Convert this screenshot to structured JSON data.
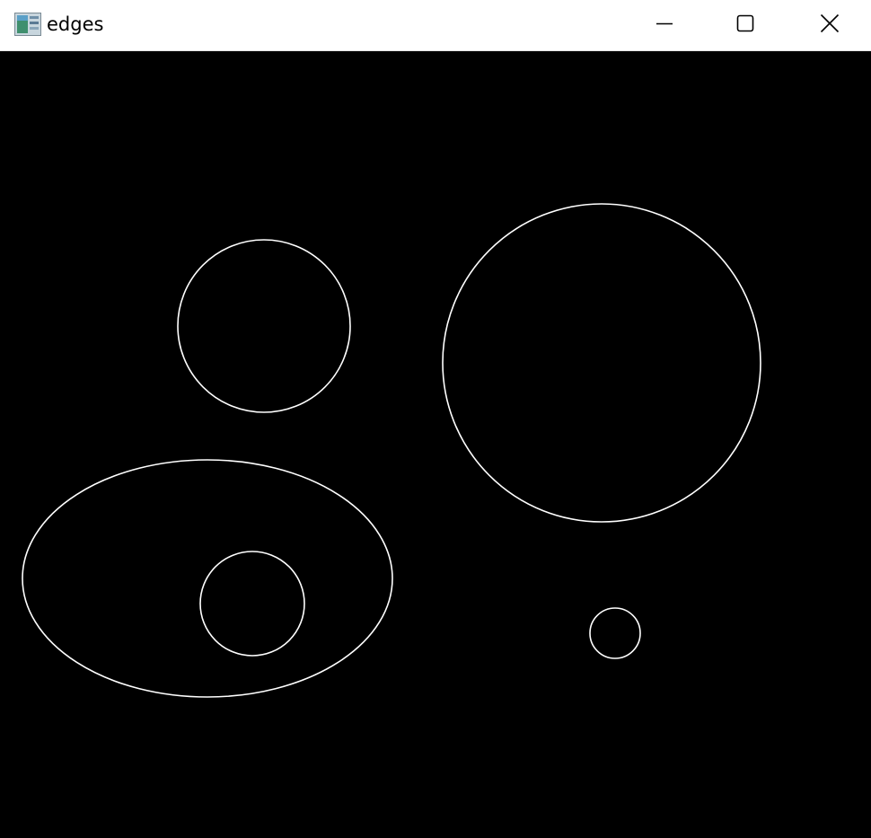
{
  "window": {
    "title": "edges",
    "icon": "image-window-icon",
    "controls": {
      "minimize": "minimize-icon",
      "maximize": "maximize-icon",
      "close": "close-icon"
    }
  },
  "image": {
    "background_color": "#000000",
    "edge_color": "#ffffff",
    "shapes": [
      {
        "name": "edge-circle-top-left",
        "kind": "circle"
      },
      {
        "name": "edge-circle-large-right",
        "kind": "circle"
      },
      {
        "name": "edge-ellipse-bottom-left",
        "kind": "ellipse"
      },
      {
        "name": "edge-circle-inside-ellipse",
        "kind": "circle"
      },
      {
        "name": "edge-circle-small-right",
        "kind": "circle"
      }
    ]
  }
}
